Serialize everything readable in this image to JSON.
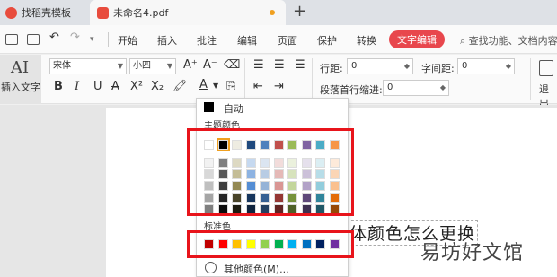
{
  "tabs": [
    {
      "label": "找稻壳模板"
    },
    {
      "label": "未命名4.pdf"
    }
  ],
  "menu": {
    "items": [
      "开始",
      "插入",
      "批注",
      "编辑",
      "页面",
      "保护",
      "转换"
    ],
    "active": "文字编辑",
    "search": "查找功能、文档内容"
  },
  "ribbon": {
    "insert_text": "插入文字",
    "font": "宋体",
    "size": "小四",
    "line_spacing_label": "行距:",
    "line_spacing_value": "0",
    "char_spacing_label": "字间距:",
    "char_spacing_value": "0",
    "indent_label": "段落首行缩进:",
    "indent_value": "0",
    "exit_label": "退出"
  },
  "document": {
    "text": "体颜色怎么更换",
    "watermark": "易坊好文馆"
  },
  "color_menu": {
    "auto_label": "自动",
    "theme_label": "主题颜色",
    "standard_label": "标准色",
    "more_label": "其他颜色(M)...",
    "theme_top": [
      "#ffffff",
      "#000000",
      "#eeece1",
      "#1f497d",
      "#4f81bd",
      "#c0504d",
      "#9bbb59",
      "#8064a2",
      "#4bacc6",
      "#f79646"
    ],
    "theme_shades": [
      [
        "#f2f2f2",
        "#7f7f7f",
        "#ddd9c3",
        "#c6d9f0",
        "#dbe5f1",
        "#f2dcdb",
        "#ebf1dd",
        "#e5e0ec",
        "#dbeef3",
        "#fdeada"
      ],
      [
        "#d8d8d8",
        "#595959",
        "#c4bd97",
        "#8db3e2",
        "#b8cce4",
        "#e5b9b7",
        "#d7e3bc",
        "#ccc1d9",
        "#b7dde8",
        "#fbd5b5"
      ],
      [
        "#bfbfbf",
        "#3f3f3f",
        "#938953",
        "#548dd4",
        "#95b3d7",
        "#d99694",
        "#c3d69b",
        "#b2a2c7",
        "#92cddc",
        "#fac08f"
      ],
      [
        "#a5a5a5",
        "#262626",
        "#494429",
        "#17365d",
        "#366092",
        "#953734",
        "#76923c",
        "#5f497a",
        "#31859b",
        "#e36c09"
      ],
      [
        "#7f7f7f",
        "#0c0c0c",
        "#1d1b10",
        "#0f243e",
        "#244061",
        "#632423",
        "#4f6128",
        "#3f3151",
        "#205867",
        "#974806"
      ]
    ],
    "standard": [
      "#c00000",
      "#ff0000",
      "#ffc000",
      "#ffff00",
      "#92d050",
      "#00b050",
      "#00b0f0",
      "#0070c0",
      "#002060",
      "#7030a0"
    ],
    "selected_color": "#000000"
  },
  "highlight_color": "#e8141b"
}
